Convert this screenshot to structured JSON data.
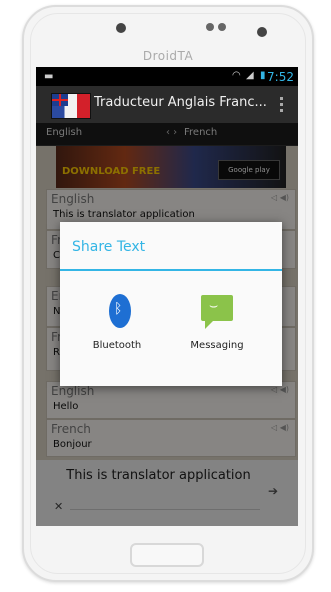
{
  "phone": {
    "brand": "DroidTA"
  },
  "status_bar": {
    "time": "7:52"
  },
  "action_bar": {
    "title": "Traducteur Anglais Franc..."
  },
  "lang_bar": {
    "source": "English",
    "swap": "‹ ›",
    "target": "French"
  },
  "banner": {
    "text": "DOWNLOAD FREE",
    "store_text": "Google play"
  },
  "cards": [
    {
      "lang": "English",
      "text": "This is translator application"
    },
    {
      "lang": "French",
      "text": "C"
    },
    {
      "lang": "English",
      "text": "N"
    },
    {
      "lang": "French",
      "text": "R"
    },
    {
      "lang": "English",
      "text": "Hello"
    },
    {
      "lang": "French",
      "text": "Bonjour"
    }
  ],
  "dialog": {
    "title": "Share Text",
    "options": [
      {
        "label": "Bluetooth",
        "icon": "bluetooth-icon"
      },
      {
        "label": "Messaging",
        "icon": "messaging-icon"
      }
    ]
  },
  "bottom_input": {
    "text": "This is translator application"
  },
  "colors": {
    "accent": "#33b5e5",
    "bluetooth": "#1e6fd3",
    "messaging": "#8bc34a"
  }
}
